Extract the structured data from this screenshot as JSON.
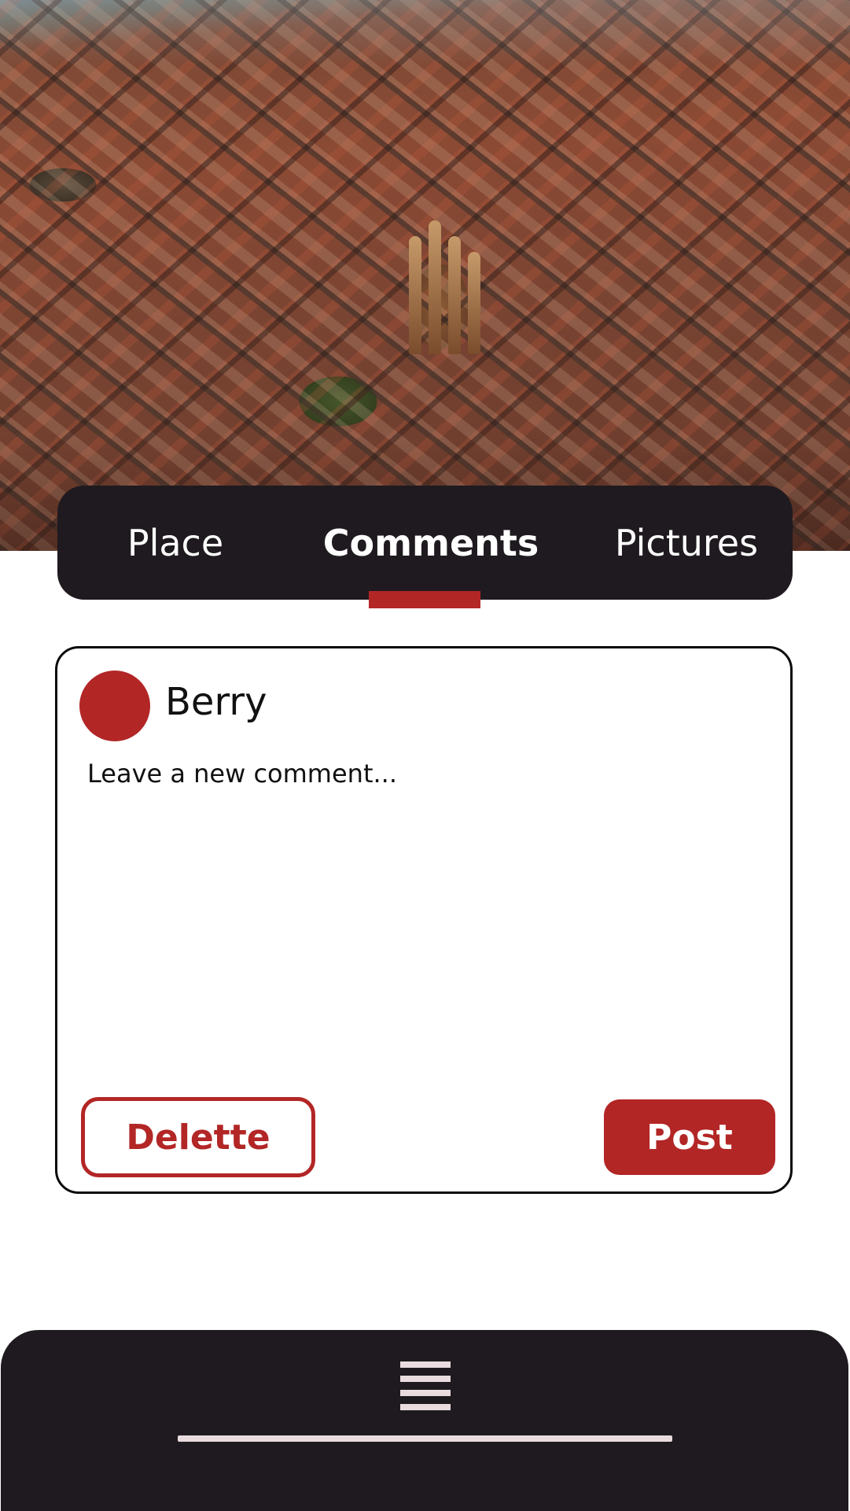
{
  "colors": {
    "accent": "#b32626",
    "dark_surface": "#1f1a1f",
    "light_line": "#e9dcdf"
  },
  "hero": {
    "image": "aerial city photo"
  },
  "tabs": [
    {
      "label": "Place",
      "active": false
    },
    {
      "label": "Comments",
      "active": true
    },
    {
      "label": "Pictures",
      "active": false
    }
  ],
  "comment": {
    "username": "Berry",
    "placeholder": "Leave a new comment...",
    "value": "",
    "delete_label": "Delette",
    "post_label": "Post"
  },
  "bottom_sheet": {
    "icon": "menu-icon"
  }
}
